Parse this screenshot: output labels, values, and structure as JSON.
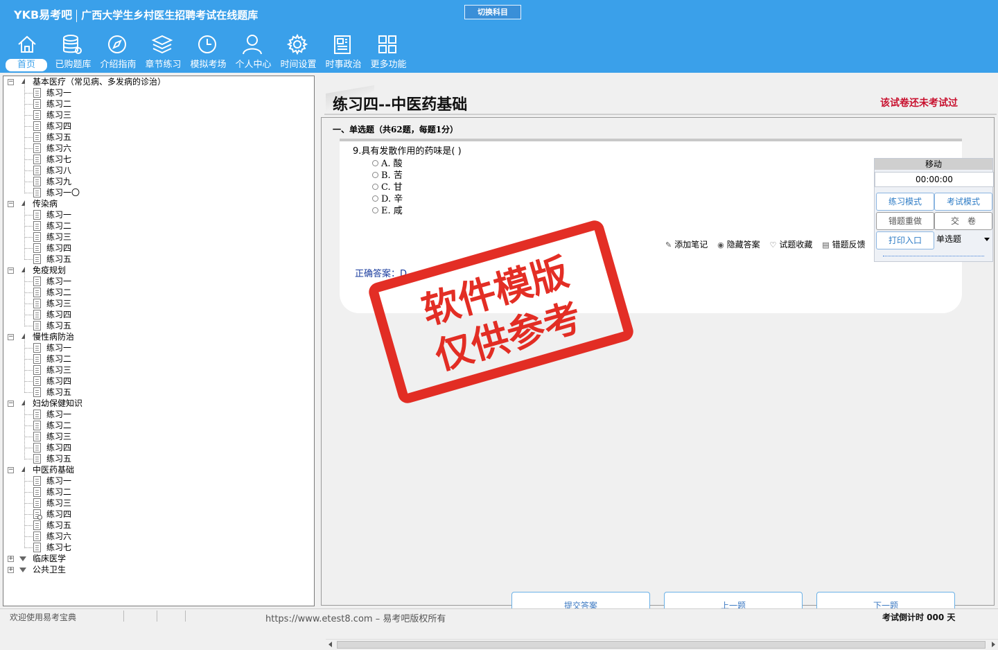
{
  "header": {
    "brand": "YKB易考吧",
    "title": "广西大学生乡村医生招聘考试在线题库",
    "switch_subject": "切换科目"
  },
  "nav": [
    {
      "label": "首页",
      "icon": "home-icon"
    },
    {
      "label": "已购题库",
      "icon": "database-icon"
    },
    {
      "label": "介绍指南",
      "icon": "compass-icon"
    },
    {
      "label": "章节练习",
      "icon": "layers-icon"
    },
    {
      "label": "模拟考场",
      "icon": "clock-icon"
    },
    {
      "label": "个人中心",
      "icon": "user-icon"
    },
    {
      "label": "时间设置",
      "icon": "gear-icon"
    },
    {
      "label": "时事政治",
      "icon": "news-icon"
    },
    {
      "label": "更多功能",
      "icon": "grid-icon"
    }
  ],
  "tree": [
    {
      "label": "基本医疗（常见病、多发病的诊治）",
      "children": [
        "练习一",
        "练习二",
        "练习三",
        "练习四",
        "练习五",
        "练习六",
        "练习七",
        "练习八",
        "练习九",
        "练习一〇"
      ]
    },
    {
      "label": "传染病",
      "children": [
        "练习一",
        "练习二",
        "练习三",
        "练习四",
        "练习五"
      ]
    },
    {
      "label": "免疫规划",
      "children": [
        "练习一",
        "练习二",
        "练习三",
        "练习四",
        "练习五"
      ]
    },
    {
      "label": "慢性病防治",
      "children": [
        "练习一",
        "练习二",
        "练习三",
        "练习四",
        "练习五"
      ]
    },
    {
      "label": "妇幼保健知识",
      "children": [
        "练习一",
        "练习二",
        "练习三",
        "练习四",
        "练习五"
      ]
    },
    {
      "label": "中医药基础",
      "children": [
        "练习一",
        "练习二",
        "练习三",
        "练习四",
        "练习五",
        "练习六",
        "练习七"
      ]
    },
    {
      "label": "临床医学",
      "children": []
    },
    {
      "label": "公共卫生",
      "children": []
    }
  ],
  "exam": {
    "title": "练习四--中医药基础",
    "status": "该试卷还未考试过",
    "section": "一、单选题（共62题，每题1分）",
    "question": "9.具有发散作用的药味是( )",
    "options": [
      "A. 酸",
      "B. 苦",
      "C. 甘",
      "D. 辛",
      "E. 咸"
    ],
    "tools": [
      "添加笔记",
      "隐藏答案",
      "试题收藏",
      "错题反馈"
    ],
    "answer": "正确答案：D"
  },
  "mini_panel": {
    "header": "移动",
    "timer": "00:00:00",
    "practice_mode": "练习模式",
    "exam_mode": "考试模式",
    "redo_wrong": "错题重做",
    "submit_paper": "交　卷",
    "print": "打印入口",
    "question_type": "单选题"
  },
  "buttons": {
    "submit": "提交答案",
    "prev": "上一题",
    "next": "下一题"
  },
  "stamp": {
    "line1": "软件模版",
    "line2": "仅供参考"
  },
  "status": {
    "welcome": "欢迎使用易考宝典",
    "copyright": "https://www.etest8.com – 易考吧版权所有",
    "countdown": "考试倒计时 000 天"
  },
  "colors": {
    "header_bg": "#3aa0ea",
    "accent_red": "#c8102e",
    "stamp_red": "#e2231a",
    "answer_blue": "#1a3c9e"
  }
}
